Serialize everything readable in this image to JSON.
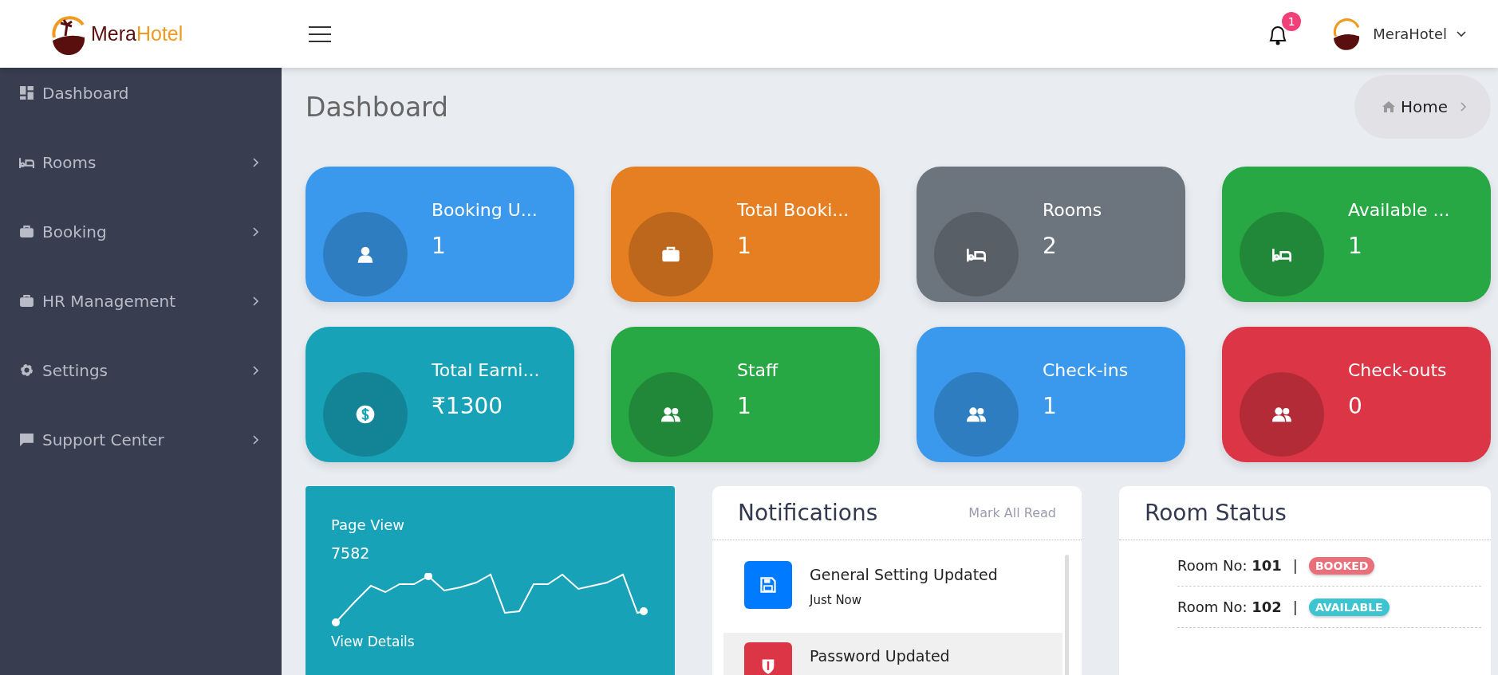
{
  "header": {
    "logo": {
      "part1": "Mera",
      "part2": "Hotel"
    },
    "notification_count": "1",
    "user": {
      "name": "MeraHotel"
    }
  },
  "sidebar": {
    "items": [
      {
        "label": "Dashboard",
        "kind": "dashboard",
        "has_submenu": false
      },
      {
        "label": "Rooms",
        "kind": "bed",
        "has_submenu": true
      },
      {
        "label": "Booking",
        "kind": "briefcase",
        "has_submenu": true
      },
      {
        "label": "HR Management",
        "kind": "briefcase",
        "has_submenu": true
      },
      {
        "label": "Settings",
        "kind": "gear",
        "has_submenu": true
      },
      {
        "label": "Support Center",
        "kind": "support",
        "has_submenu": true
      }
    ]
  },
  "page": {
    "title": "Dashboard",
    "breadcrumb": "Home"
  },
  "stat_cards": [
    {
      "label": "Booking U...",
      "value": "1",
      "kind": "user",
      "color": "#3a99ec"
    },
    {
      "label": "Total Booki...",
      "value": "1",
      "kind": "briefcase",
      "color": "#e67e22"
    },
    {
      "label": "Rooms",
      "value": "2",
      "kind": "bed",
      "color": "#6c757d"
    },
    {
      "label": "Available ...",
      "value": "1",
      "kind": "bed",
      "color": "#28a745"
    },
    {
      "label": "Total Earni...",
      "value": "₹1300",
      "kind": "dollar",
      "color": "#17a2b8"
    },
    {
      "label": "Staff",
      "value": "1",
      "kind": "users",
      "color": "#28a745"
    },
    {
      "label": "Check-ins",
      "value": "1",
      "kind": "users",
      "color": "#3a99ec"
    },
    {
      "label": "Check-outs",
      "value": "0",
      "kind": "users",
      "color": "#dc3545"
    }
  ],
  "page_view": {
    "title": "Page View",
    "value": "7582",
    "link": "View Details"
  },
  "notifications": {
    "title": "Notifications",
    "action": "Mark All Read",
    "items": [
      {
        "title": "General Setting Updated",
        "time": "Just Now",
        "kind": "save",
        "color": "#007bff",
        "highlighted": false
      },
      {
        "title": "Password Updated",
        "kind": "shield",
        "color": "#dc3545",
        "highlighted": true
      }
    ]
  },
  "room_status": {
    "title": "Room Status",
    "rooms": [
      {
        "text": "Room No: **101**",
        "separator": "|",
        "status": "BOOKED",
        "color": "#e9707a"
      },
      {
        "text": "Room No: **102**",
        "separator": "|",
        "status": "AVAILABLE",
        "color": "#3cc4d0"
      }
    ]
  }
}
